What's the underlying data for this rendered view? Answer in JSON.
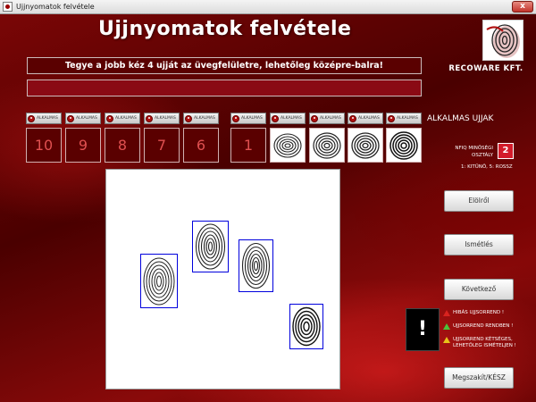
{
  "window": {
    "title": "Ujjnyomatok felvétele",
    "close": "x"
  },
  "app": {
    "title": "Ujjnyomatok felvétele"
  },
  "logo": {
    "brand": "RECOWARE KFT."
  },
  "instruction": "Tegye a jobb kéz 4 ujját az üvegfelületre, lehetőleg középre-balra!",
  "finger_buttons": [
    "ALKALMAS",
    "ALKALMAS",
    "ALKALMAS",
    "ALKALMAS",
    "ALKALMAS",
    "ALKALMAS",
    "ALKALMAS",
    "ALKALMAS",
    "ALKALMAS",
    "ALKALMAS"
  ],
  "finger_numbers": [
    "10",
    "9",
    "8",
    "7",
    "6",
    "1"
  ],
  "right": {
    "suitable_title": "ALKALMAS UJJAK",
    "nfiq_label": "NFIQ MINŐSÉGI OSZTÁLY",
    "nfiq_value": "2",
    "nfiq_legend": "1: KITŰNŐ, 5: ROSSZ"
  },
  "buttons": {
    "restart": "Elölről",
    "repeat": "Ismétlés",
    "next": "Következő",
    "cancel_done": "Megszakít/KÉSZ"
  },
  "status": {
    "alert_symbol": "!",
    "wrong_order": "HIBÁS UJJSORREND !",
    "order_ok": "UJJSORREND RENDBEN !",
    "order_doubtful": "UJJSORREND KÉTSÉGES, LEHETŐLEG ISMÉTELJEN !"
  },
  "colors": {
    "wrong": "#d8231f",
    "ok": "#4cc23a",
    "doubtful": "#e8c21a",
    "nfiq": "#d31b2a"
  }
}
